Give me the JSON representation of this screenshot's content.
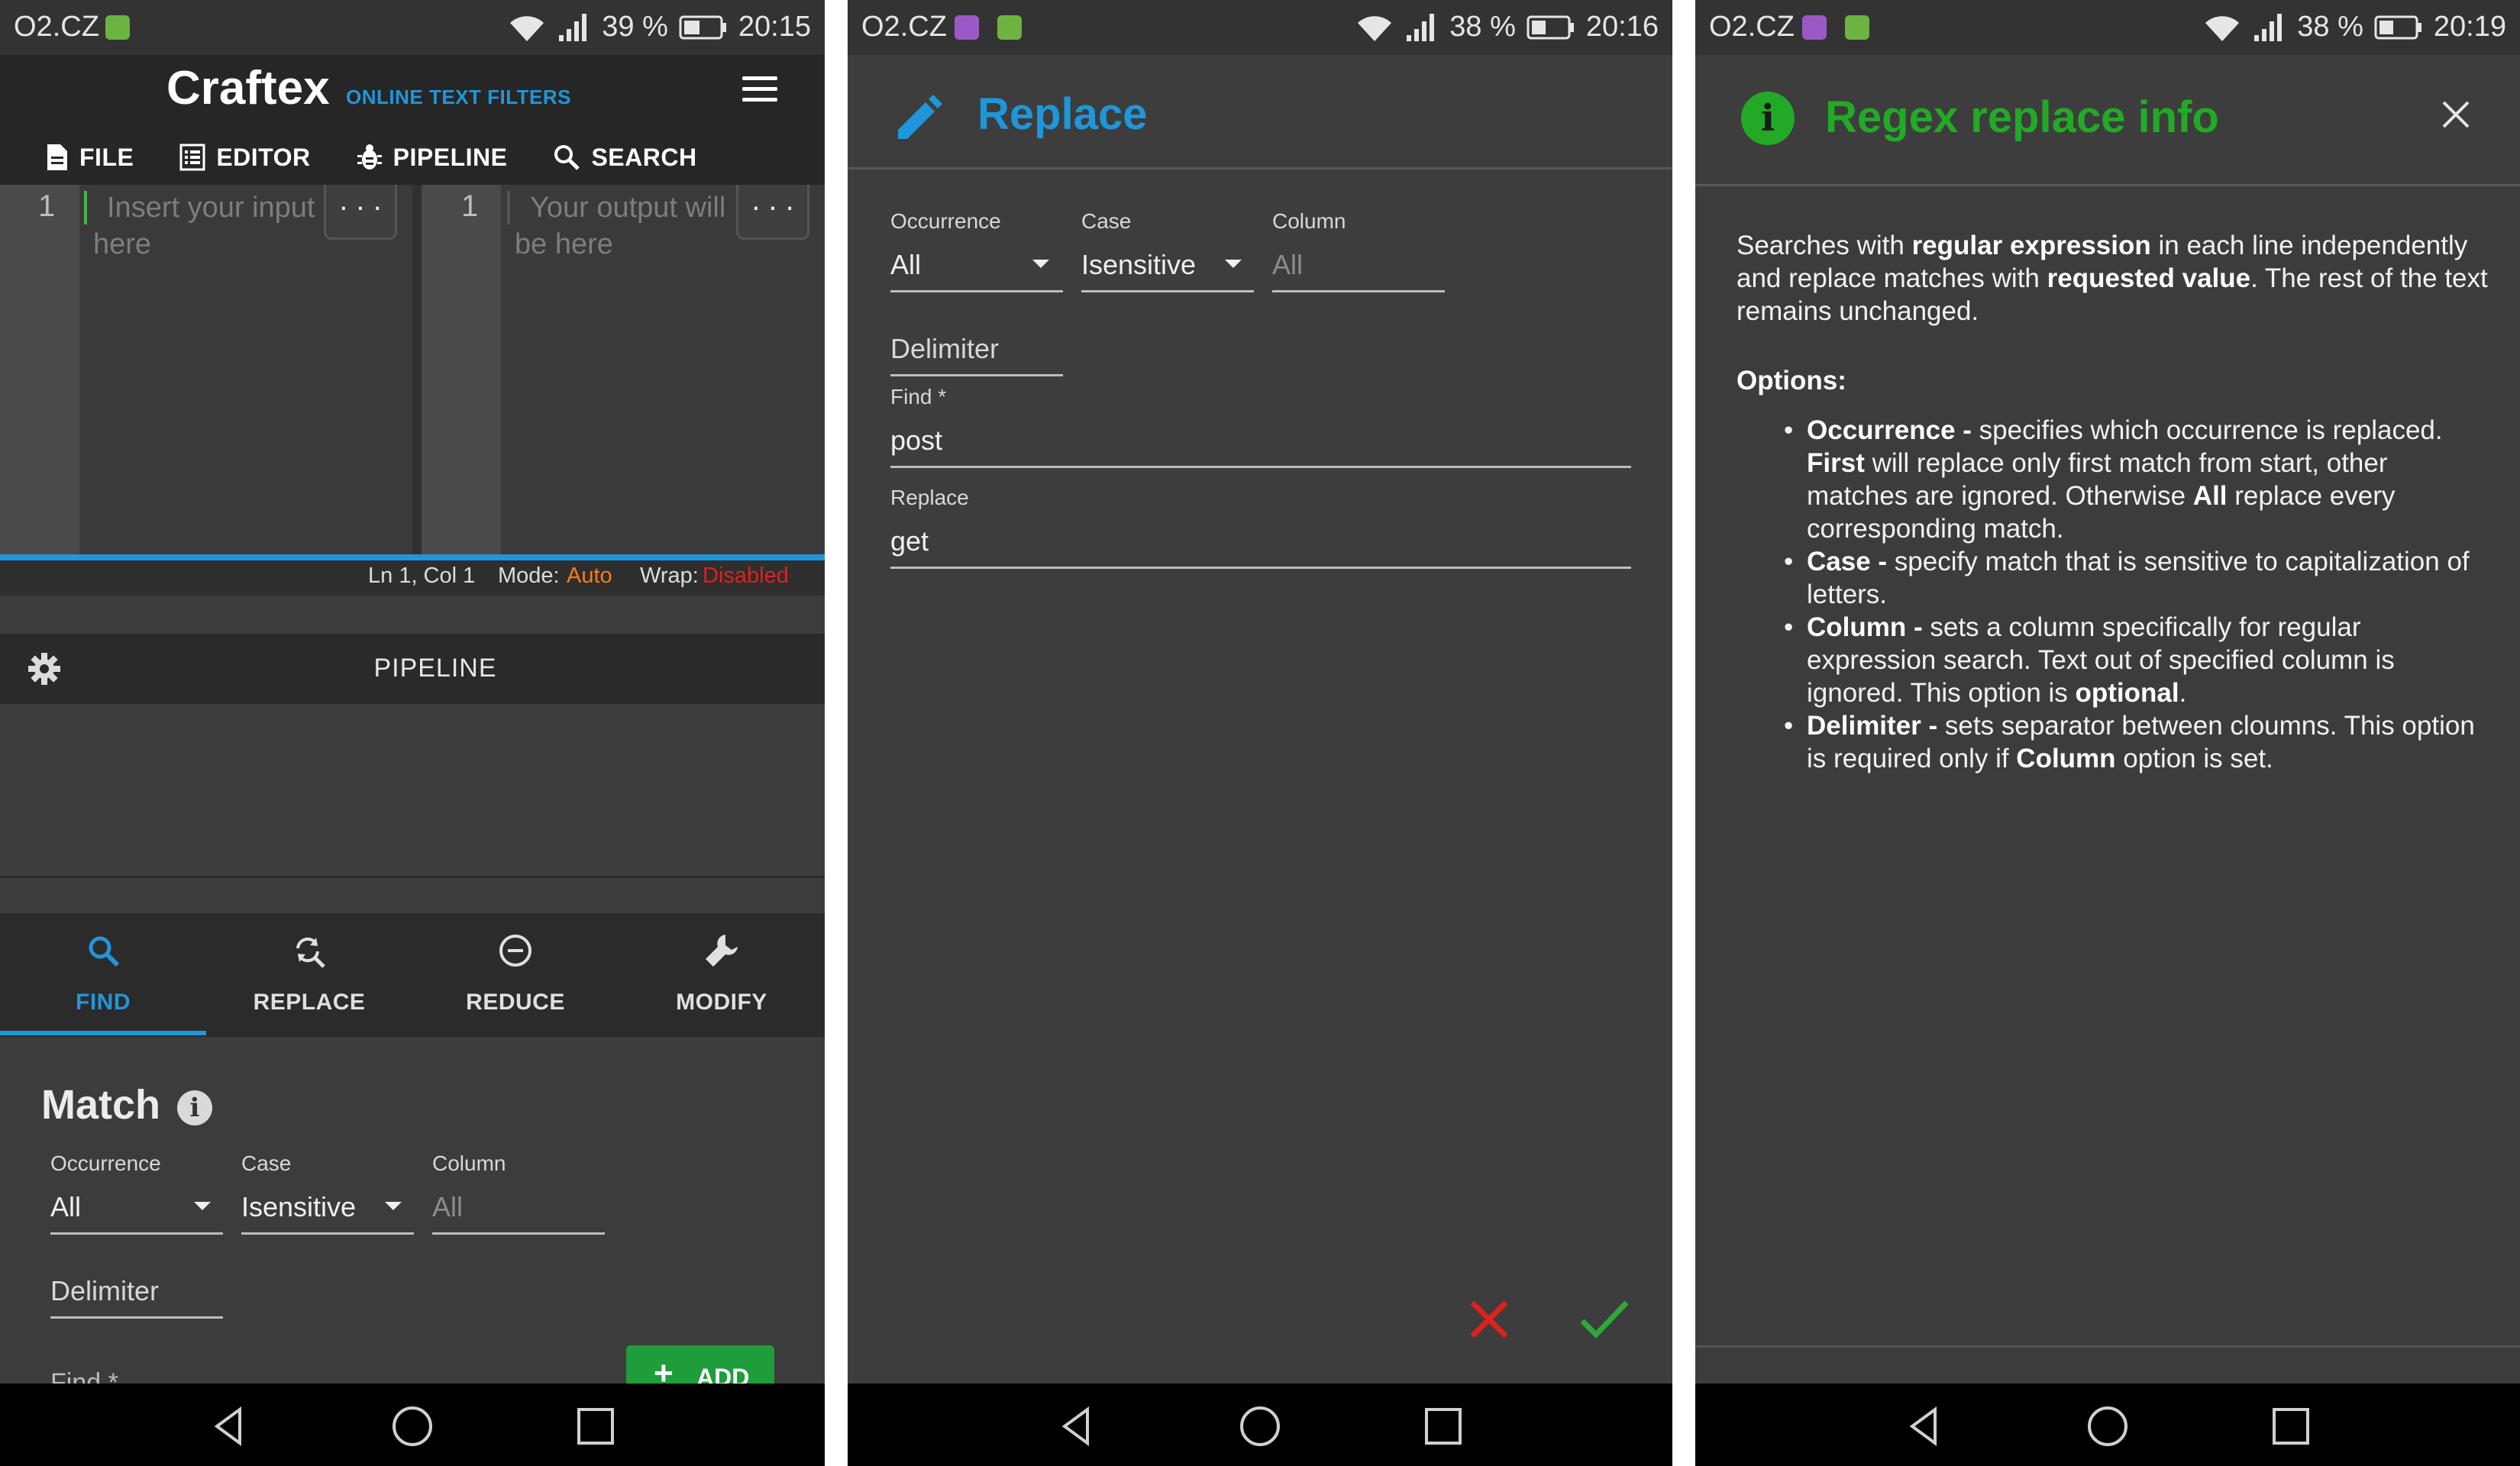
{
  "screen_a": {
    "status": {
      "carrier": "O2.CZ",
      "battery": "39 %",
      "time": "20:15"
    },
    "app": {
      "brand": "Craftex",
      "subtitle": "ONLINE TEXT FILTERS"
    },
    "menu": [
      {
        "label": "FILE",
        "icon": "file-icon"
      },
      {
        "label": "EDITOR",
        "icon": "editor-icon"
      },
      {
        "label": "PIPELINE",
        "icon": "bug-icon"
      },
      {
        "label": "SEARCH",
        "icon": "search-icon"
      }
    ],
    "input_editor": {
      "line": "1",
      "placeholder_1": "Insert your input",
      "placeholder_2": "here",
      "more": ". . ."
    },
    "output_editor": {
      "line": "1",
      "placeholder_1": "Your output will",
      "placeholder_2": "be here",
      "more": ". . ."
    },
    "status_line": {
      "position": "Ln 1, Col 1",
      "mode_label": "Mode:",
      "mode_value": "Auto",
      "wrap_label": "Wrap:",
      "wrap_value": "Disabled"
    },
    "pipeline": {
      "label": "PIPELINE"
    },
    "tabs": [
      {
        "label": "FIND",
        "icon": "search-icon",
        "active": true
      },
      {
        "label": "REPLACE",
        "icon": "find-replace-icon",
        "active": false
      },
      {
        "label": "REDUCE",
        "icon": "minus-circle-icon",
        "active": false
      },
      {
        "label": "MODIFY",
        "icon": "wrench-icon",
        "active": false
      }
    ],
    "match": {
      "title": "Match",
      "occurrence_label": "Occurrence",
      "occurrence_value": "All",
      "case_label": "Case",
      "case_value": "Isensitive",
      "column_label": "Column",
      "column_placeholder": "All",
      "delimiter_placeholder": "Delimiter",
      "add_label": "ADD",
      "find_peek": "Find *"
    }
  },
  "screen_b": {
    "status": {
      "carrier": "O2.CZ",
      "battery": "38 %",
      "time": "20:16"
    },
    "title": "Replace",
    "occurrence_label": "Occurrence",
    "occurrence_value": "All",
    "case_label": "Case",
    "case_value": "Isensitive",
    "column_label": "Column",
    "column_placeholder": "All",
    "delimiter_placeholder": "Delimiter",
    "find_label": "Find *",
    "find_value": "post",
    "replace_label": "Replace",
    "replace_value": "get"
  },
  "screen_c": {
    "status": {
      "carrier": "O2.CZ",
      "battery": "38 %",
      "time": "20:19"
    },
    "title": "Regex replace info",
    "intro": {
      "t1": "Searches with ",
      "b1": "regular expression",
      "t2": " in each line independently and replace matches with ",
      "b2": "requested value",
      "t3": ". The rest of the text remains unchanged."
    },
    "options_heading": "Options:",
    "bullets": {
      "occurrence": {
        "name": "Occurrence -",
        "t1": " specifies which occurrence is replaced. ",
        "b1": "First",
        "t2": " will replace only first match from start, other matches are ignored. Otherwise ",
        "b2": "All",
        "t3": " replace every corresponding match."
      },
      "case": {
        "name": "Case -",
        "t1": " specify match that is sensitive to capitalization of letters."
      },
      "column": {
        "name": "Column -",
        "t1": " sets a column specifically for regular expression search. Text out of specified column is ignored. This option is ",
        "b1": "optional",
        "t2": "."
      },
      "delimiter": {
        "name": "Delimiter -",
        "t1": " sets separator between cloumns. This option is required only if ",
        "b1": "Column",
        "t2": " option is set."
      }
    }
  },
  "colors": {
    "accent_blue": "#2196d8",
    "accent_green": "#22aa26",
    "warning_orange": "#ff7a18",
    "error_red": "#e0211b"
  }
}
